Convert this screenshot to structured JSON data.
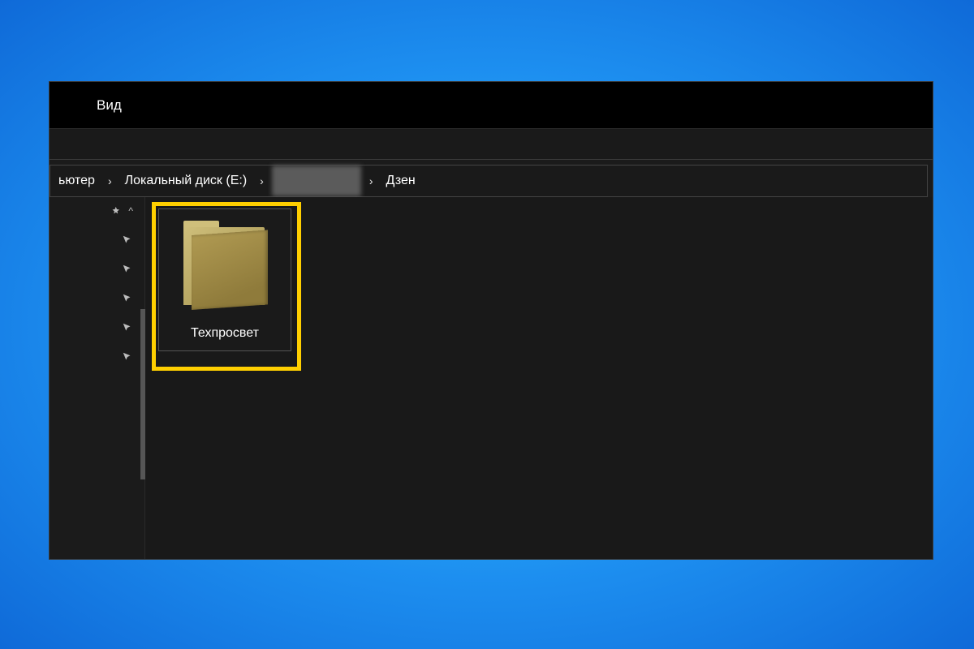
{
  "menu": {
    "view": "Вид"
  },
  "breadcrumb": {
    "seg0": "ьютер",
    "seg1": "Локальный диск (E:)",
    "seg2_redacted": true,
    "seg3": "Дзен"
  },
  "sidebar": {
    "pins": [
      "",
      "",
      "",
      "",
      "",
      ""
    ]
  },
  "content": {
    "folders": [
      {
        "label": "Техпросвет"
      }
    ]
  },
  "colors": {
    "highlight": "#ffcf00"
  }
}
